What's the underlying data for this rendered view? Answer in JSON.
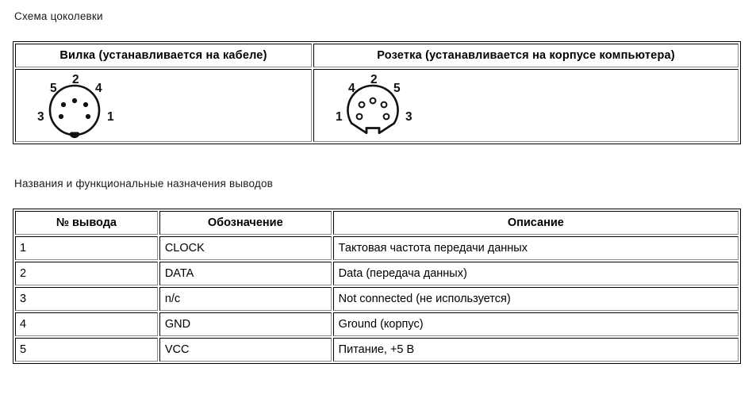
{
  "page": {
    "pinout_heading": "Схема цоколевки",
    "pin_names_heading": "Названия и функциональные назначения выводов"
  },
  "connector_table": {
    "headers": {
      "plug": "Вилка (устанавливается на кабеле)",
      "socket": "Розетка (устанавливается на корпусе компьютера)"
    },
    "plug_diagram": {
      "icon": "din5-plug-icon",
      "type": "plug",
      "pin_style": "solid",
      "key_style": "filled-tab",
      "labels": [
        {
          "number": "5",
          "position": "upper-left"
        },
        {
          "number": "2",
          "position": "top"
        },
        {
          "number": "4",
          "position": "upper-right"
        },
        {
          "number": "3",
          "position": "left"
        },
        {
          "number": "1",
          "position": "right"
        }
      ]
    },
    "socket_diagram": {
      "icon": "din5-socket-icon",
      "type": "socket",
      "pin_style": "hollow",
      "key_style": "open-notch",
      "labels": [
        {
          "number": "4",
          "position": "upper-left"
        },
        {
          "number": "2",
          "position": "top"
        },
        {
          "number": "5",
          "position": "upper-right"
        },
        {
          "number": "1",
          "position": "left"
        },
        {
          "number": "3",
          "position": "right"
        }
      ]
    }
  },
  "pin_table": {
    "headers": [
      "№ вывода",
      "Обозначение",
      "Описание"
    ],
    "rows": [
      {
        "num": "1",
        "signal": "CLOCK",
        "description": "Тактовая частота передачи данных"
      },
      {
        "num": "2",
        "signal": "DATA",
        "description": "Data (передача данных)"
      },
      {
        "num": "3",
        "signal": "n/c",
        "description": "Not connected (не используется)"
      },
      {
        "num": "4",
        "signal": "GND",
        "description": "Ground (корпус)"
      },
      {
        "num": "5",
        "signal": "VCC",
        "description": "Питание, +5 В"
      }
    ]
  },
  "colors": {
    "background": "#ffffff",
    "text": "#000000",
    "border_dark": "#000000",
    "border_shadow": "#8a8a8a"
  }
}
